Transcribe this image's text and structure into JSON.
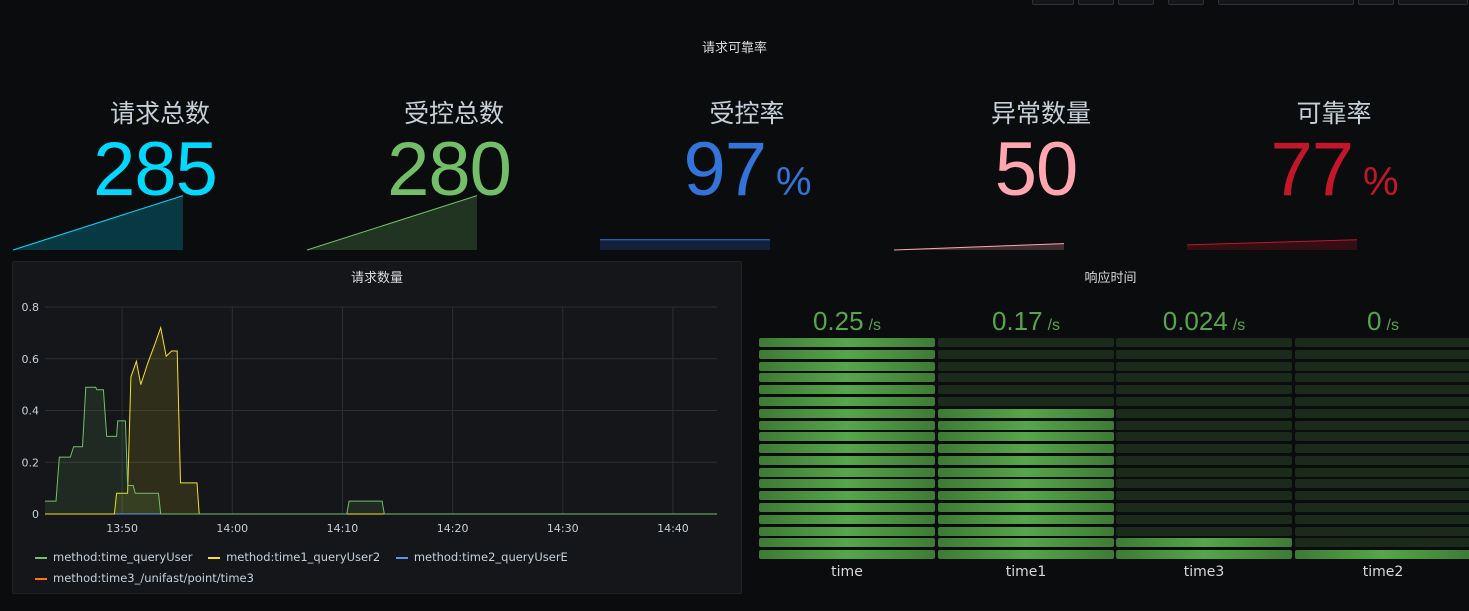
{
  "row": {
    "title": "请求可靠率"
  },
  "stats": [
    {
      "id": "total",
      "label": "请求总数",
      "value": "285",
      "unit": "",
      "color": "#00d8ff",
      "trend": [
        0.0,
        0.85
      ]
    },
    {
      "id": "ctrl",
      "label": "受控总数",
      "value": "280",
      "unit": "",
      "color": "#73bf69",
      "trend": [
        0.0,
        0.85
      ]
    },
    {
      "id": "ratio",
      "label": "受控率",
      "value": "97",
      "unit": "%",
      "color": "#3274d9",
      "trend": [
        0.16,
        0.16
      ]
    },
    {
      "id": "errors",
      "label": "异常数量",
      "value": "50",
      "unit": "",
      "color": "#ffa6b0",
      "trend": [
        0.0,
        0.1
      ]
    },
    {
      "id": "rel",
      "label": "可靠率",
      "value": "77",
      "unit": "%",
      "color": "#c4162a",
      "trend": [
        0.08,
        0.16
      ]
    }
  ],
  "requests_panel": {
    "title": "请求数量",
    "legend": [
      {
        "name": "method:time_queryUser",
        "color": "#73bf69"
      },
      {
        "name": "method:time1_queryUser2",
        "color": "#fade2a"
      },
      {
        "name": "method:time2_queryUserE",
        "color": "#5794f2"
      },
      {
        "name": "method:time3_/unifast/point/time3",
        "color": "#ff780a"
      }
    ]
  },
  "chart_data": {
    "type": "area",
    "title": "请求数量",
    "ylim": [
      0,
      0.8
    ],
    "yticks": [
      "0",
      "0.2",
      "0.4",
      "0.6",
      "0.8"
    ],
    "xticks": [
      "13:50",
      "14:00",
      "14:10",
      "14:20",
      "14:30",
      "14:40"
    ],
    "xrange_minutes": [
      "13:43",
      "14:44"
    ],
    "grid": true,
    "legend_position": "bottom",
    "series": [
      {
        "name": "method:time_queryUser",
        "color": "#73bf69",
        "points": [
          [
            "13:43",
            0.05
          ],
          [
            "13:44",
            0.05
          ],
          [
            "13:44.3",
            0.22
          ],
          [
            "13:45.3",
            0.22
          ],
          [
            "13:45.6",
            0.26
          ],
          [
            "13:46.4",
            0.26
          ],
          [
            "13:46.7",
            0.49
          ],
          [
            "13:47.6",
            0.49
          ],
          [
            "13:47.7",
            0.48
          ],
          [
            "13:48.3",
            0.48
          ],
          [
            "13:48.6",
            0.3
          ],
          [
            "13:49.5",
            0.3
          ],
          [
            "13:49.6",
            0.36
          ],
          [
            "13:50.3",
            0.36
          ],
          [
            "13:50.5",
            0.11
          ],
          [
            "13:51.0",
            0.11
          ],
          [
            "13:51.2",
            0.08
          ],
          [
            "13:53.3",
            0.08
          ],
          [
            "13:53.5",
            0.0
          ],
          [
            "14:10.4",
            0.0
          ],
          [
            "14:10.6",
            0.05
          ],
          [
            "14:13.6",
            0.05
          ],
          [
            "14:13.8",
            0.0
          ],
          [
            "14:44",
            0.0
          ]
        ]
      },
      {
        "name": "method:time1_queryUser2",
        "color": "#fade2a",
        "points": [
          [
            "13:43",
            0.0
          ],
          [
            "13:49.3",
            0.0
          ],
          [
            "13:49.5",
            0.08
          ],
          [
            "13:50.5",
            0.08
          ],
          [
            "13:50.8",
            0.53
          ],
          [
            "13:51.3",
            0.59
          ],
          [
            "13:51.7",
            0.5
          ],
          [
            "13:52.3",
            0.58
          ],
          [
            "13:53.0",
            0.66
          ],
          [
            "13:53.5",
            0.72
          ],
          [
            "13:54.0",
            0.61
          ],
          [
            "13:54.5",
            0.63
          ],
          [
            "13:55.0",
            0.63
          ],
          [
            "13:55.3",
            0.12
          ],
          [
            "13:56.8",
            0.12
          ],
          [
            "13:57.0",
            0.0
          ],
          [
            "14:44",
            0.0
          ]
        ]
      },
      {
        "name": "method:time2_queryUserE",
        "color": "#5794f2",
        "points": [
          [
            "13:43",
            0.0
          ],
          [
            "14:44",
            0.0
          ]
        ]
      },
      {
        "name": "method:time3_/unifast/point/time3",
        "color": "#ff780a",
        "points": [
          [
            "13:43",
            0.0
          ],
          [
            "14:44",
            0.0
          ]
        ]
      }
    ]
  },
  "response_panel": {
    "title": "响应时间",
    "unit": "/s",
    "segments_total": 19,
    "lit_color": "#56a64b",
    "dim_color": "#1b2a1a",
    "gauges": [
      {
        "name": "time",
        "value": "0.25",
        "level": 1.0
      },
      {
        "name": "time1",
        "value": "0.17",
        "level": 0.68
      },
      {
        "name": "time3",
        "value": "0.024",
        "level": 0.1
      },
      {
        "name": "time2",
        "value": "0",
        "level": 0.053
      }
    ]
  }
}
